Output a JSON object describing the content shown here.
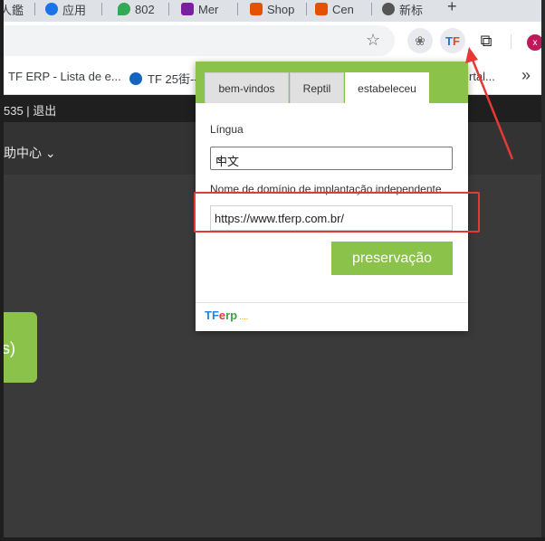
{
  "browser": {
    "tabs": [
      {
        "label": "人鑑",
        "color": "#7e57c2"
      },
      {
        "label": "应用",
        "color": "#1a73e8"
      },
      {
        "label": "802",
        "color": "#34a853"
      },
      {
        "label": "Mer",
        "color": "#7b1fa2"
      },
      {
        "label": "Shop",
        "color": "#e65100"
      },
      {
        "label": "Cen",
        "color": "#e65100"
      },
      {
        "label": "新标",
        "color": "#555555"
      }
    ],
    "new_tab_label": "+",
    "extensions": {
      "ext1_glyph": "❀",
      "tf_t": "T",
      "tf_f": "F",
      "puzzle_glyph": "⧉"
    },
    "avatar_letter": "x"
  },
  "bookmarks": [
    {
      "label": "TF ERP - Lista de e...",
      "color": "#1a73e8"
    },
    {
      "label": "TF 25街--",
      "color": "#1565c0"
    },
    {
      "label": "rtal...",
      "color": "#555555"
    }
  ],
  "bookmarks_more": "»",
  "site": {
    "user_info": "535 | 退出",
    "nav_help": "助中心 ⌄",
    "card_text": "s)"
  },
  "popup": {
    "tabs": [
      "bem-vindos",
      "Reptil",
      "estabeleceu"
    ],
    "language_label": "Língua",
    "language_value": "中文",
    "domain_label": "Nome de domínio de implantação independente",
    "domain_value": "https://www.tferp.com.br/",
    "save_label": "preservação",
    "logo_tf": "TF",
    "logo_e": "e",
    "logo_rp": "rp",
    "logo_dots": "...."
  },
  "colors": {
    "accent": "#8bc34a",
    "annotation": "#e53935"
  }
}
